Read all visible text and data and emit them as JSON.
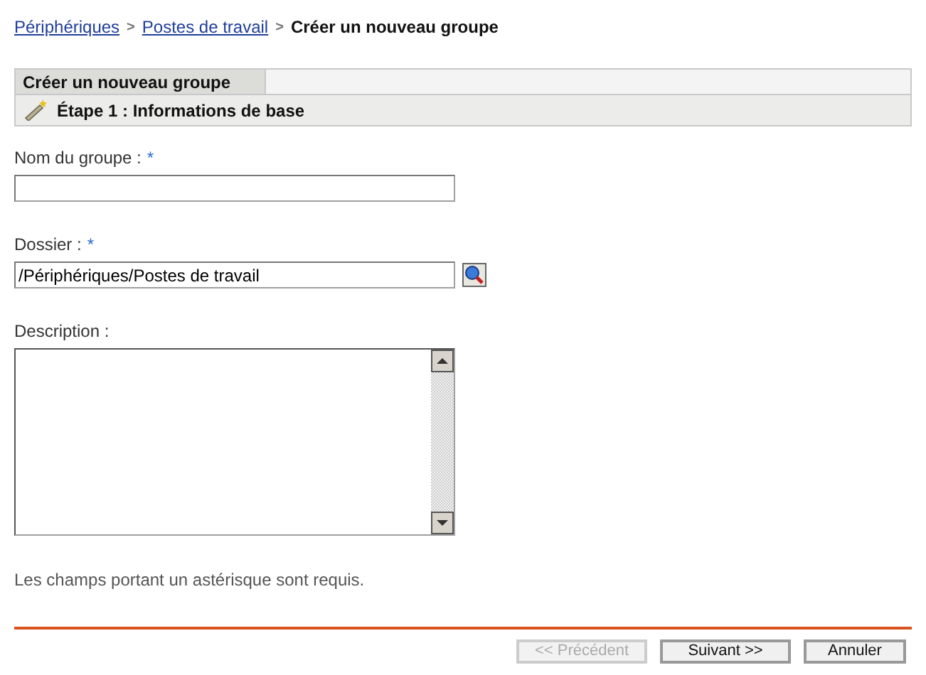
{
  "breadcrumb": {
    "links": [
      "Périphériques",
      "Postes de travail"
    ],
    "separator": ">",
    "current": "Créer un nouveau groupe"
  },
  "panel": {
    "title": "Créer un nouveau groupe",
    "step": "Étape 1 : Informations de base"
  },
  "fields": [
    {
      "kind": "text",
      "label": "Nom du groupe :",
      "required": true
    },
    {
      "kind": "browse",
      "label": "Dossier :",
      "required": true,
      "value": "/Périphériques/Postes de travail"
    },
    {
      "kind": "textarea",
      "label": "Description :",
      "required": false
    }
  ],
  "required_mark": "*",
  "note": "Les champs portant un astérisque sont requis.",
  "buttons": [
    {
      "label": "<< Précédent",
      "disabled": true
    },
    {
      "label": "Suivant >>",
      "disabled": false
    },
    {
      "label": "Annuler",
      "disabled": false
    }
  ]
}
